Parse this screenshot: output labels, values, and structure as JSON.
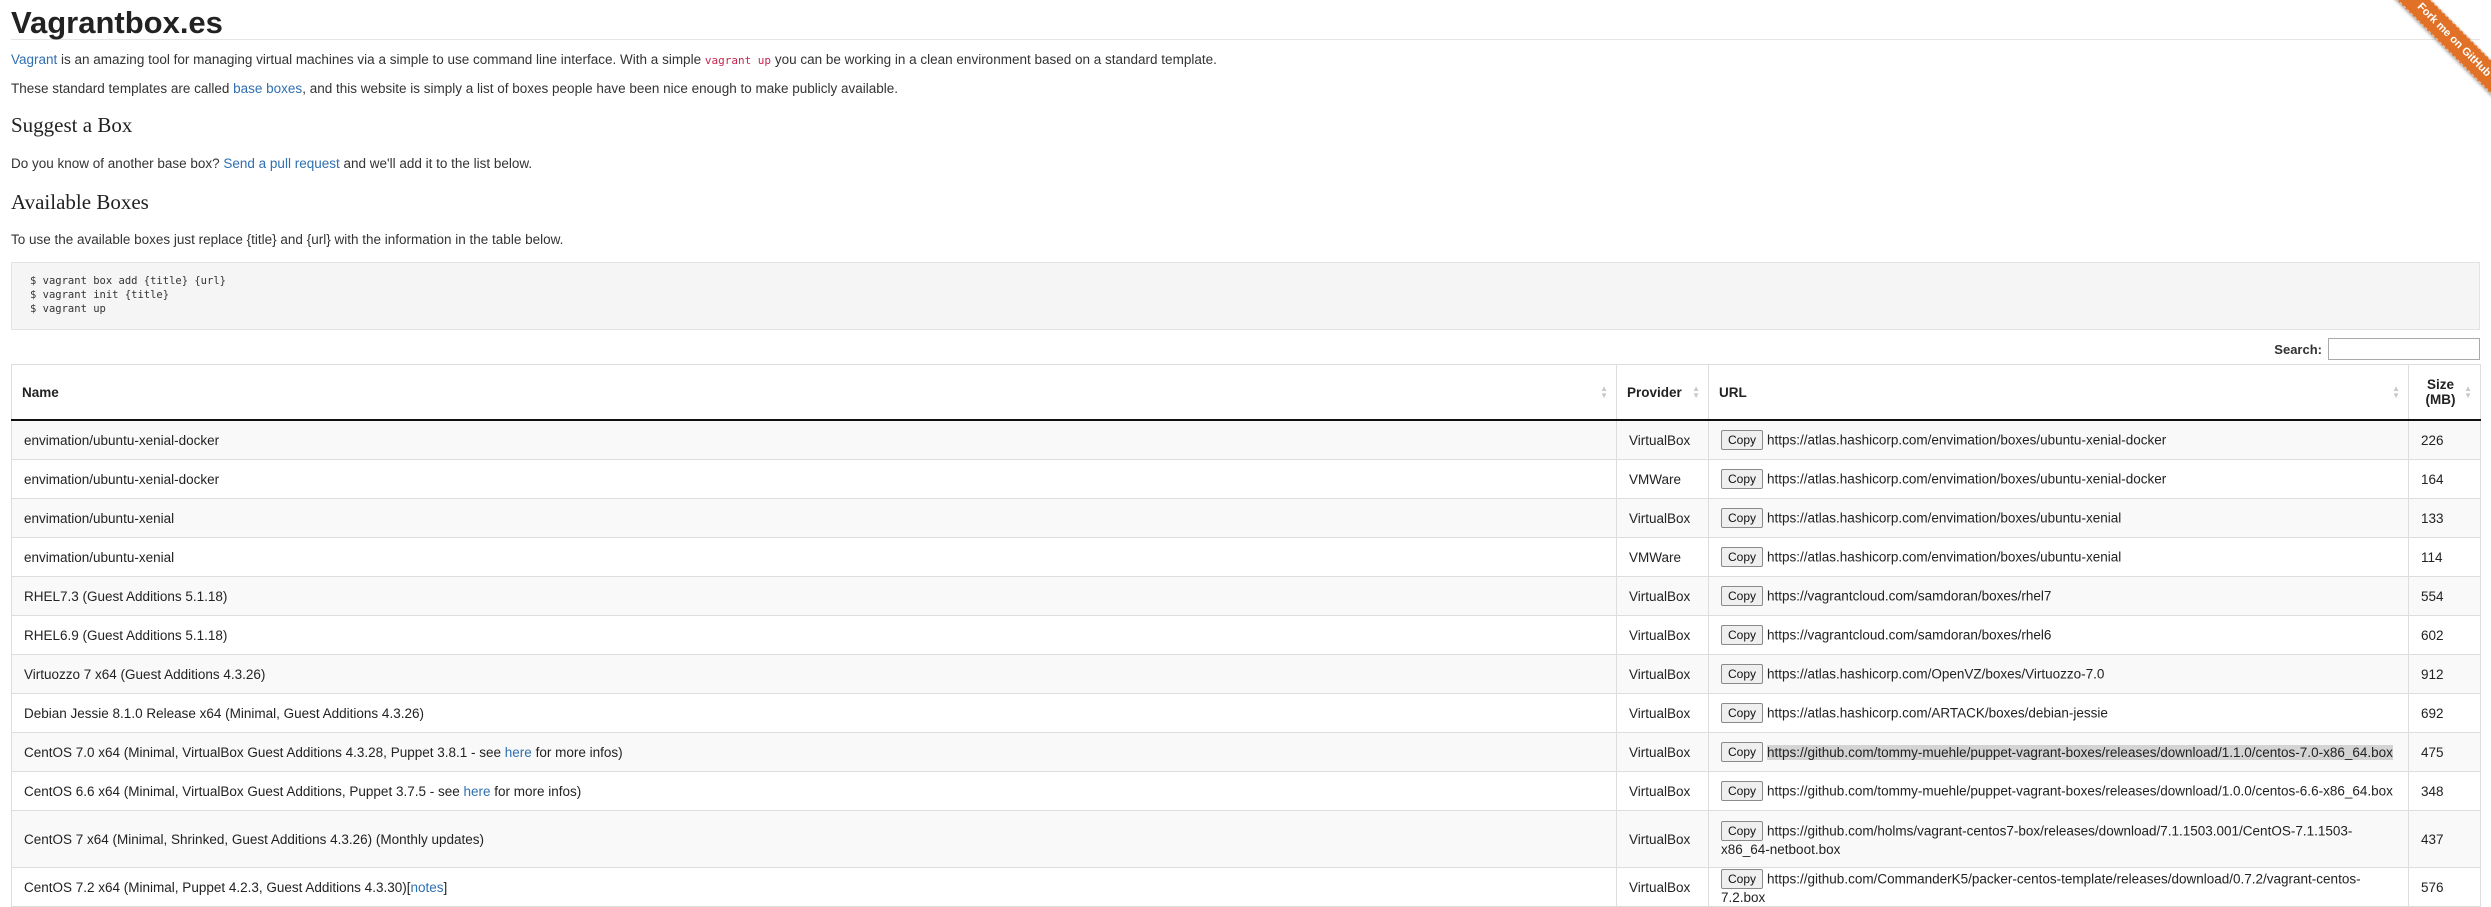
{
  "site": {
    "title": "Vagrantbox.es"
  },
  "ribbon": {
    "label": "Fork me on GitHub"
  },
  "intro": {
    "vagrant_link": "Vagrant",
    "text1": " is an amazing tool for managing virtual machines via a simple to use command line interface. With a simple ",
    "code": "vagrant up",
    "text2": " you can be working in a clean environment based on a standard template.",
    "text3": "These standard templates are called ",
    "base_boxes_link": "base boxes",
    "text4": ", and this website is simply a list of boxes people have been nice enough to make publicly available."
  },
  "suggest": {
    "heading": "Suggest a Box",
    "text1": "Do you know of another base box? ",
    "link": "Send a pull request",
    "text2": " and we'll add it to the list below."
  },
  "available": {
    "heading": "Available Boxes",
    "text": "To use the available boxes just replace {title} and {url} with the information in the table below.",
    "code_lines": [
      "$ vagrant box add {title} {url}",
      "$ vagrant init {title}",
      "$ vagrant up"
    ]
  },
  "search": {
    "label": "Search:",
    "value": ""
  },
  "table": {
    "headers": {
      "name": "Name",
      "provider": "Provider",
      "url": "URL",
      "size": "Size (MB)"
    },
    "copy_label": "Copy",
    "rows": [
      {
        "name": "envimation/ubuntu-xenial-docker",
        "provider": "VirtualBox",
        "url": "https://atlas.hashicorp.com/envimation/boxes/ubuntu-xenial-docker",
        "size": "226"
      },
      {
        "name": "envimation/ubuntu-xenial-docker",
        "provider": "VMWare",
        "url": "https://atlas.hashicorp.com/envimation/boxes/ubuntu-xenial-docker",
        "size": "164"
      },
      {
        "name": "envimation/ubuntu-xenial",
        "provider": "VirtualBox",
        "url": "https://atlas.hashicorp.com/envimation/boxes/ubuntu-xenial",
        "size": "133"
      },
      {
        "name": "envimation/ubuntu-xenial",
        "provider": "VMWare",
        "url": "https://atlas.hashicorp.com/envimation/boxes/ubuntu-xenial",
        "size": "114"
      },
      {
        "name": "RHEL7.3 (Guest Additions 5.1.18)",
        "provider": "VirtualBox",
        "url": "https://vagrantcloud.com/samdoran/boxes/rhel7",
        "size": "554"
      },
      {
        "name": "RHEL6.9 (Guest Additions 5.1.18)",
        "provider": "VirtualBox",
        "url": "https://vagrantcloud.com/samdoran/boxes/rhel6",
        "size": "602"
      },
      {
        "name": "Virtuozzo 7 x64 (Guest Additions 4.3.26)",
        "provider": "VirtualBox",
        "url": "https://atlas.hashicorp.com/OpenVZ/boxes/Virtuozzo-7.0",
        "size": "912"
      },
      {
        "name": "Debian Jessie 8.1.0 Release x64 (Minimal, Guest Additions 4.3.26)",
        "provider": "VirtualBox",
        "url": "https://atlas.hashicorp.com/ARTACK/boxes/debian-jessie",
        "size": "692"
      },
      {
        "name": "CentOS 7.0 x64 (Minimal, VirtualBox Guest Additions 4.3.28, Puppet 3.8.1 - see ",
        "link": "here",
        "name_after": " for more infos)",
        "provider": "VirtualBox",
        "url": "https://github.com/tommy-muehle/puppet-vagrant-boxes/releases/download/1.1.0/centos-7.0-x86_64.box",
        "size": "475",
        "selected": true
      },
      {
        "name": "CentOS 6.6 x64 (Minimal, VirtualBox Guest Additions, Puppet 3.7.5 - see ",
        "link": "here",
        "name_after": " for more infos)",
        "provider": "VirtualBox",
        "url": "https://github.com/tommy-muehle/puppet-vagrant-boxes/releases/download/1.0.0/centos-6.6-x86_64.box",
        "size": "348"
      },
      {
        "name": "CentOS 7 x64 (Minimal, Shrinked, Guest Additions 4.3.26) (Monthly updates)",
        "provider": "VirtualBox",
        "url": "https://github.com/holms/vagrant-centos7-box/releases/download/7.1.1503.001/CentOS-7.1.1503-x86_64-netboot.box",
        "size": "437",
        "tall": true
      },
      {
        "name": "CentOS 7.2 x64 (Minimal, Puppet 4.2.3, Guest Additions 4.3.30)[",
        "link": "notes",
        "name_after": "]",
        "provider": "VirtualBox",
        "url": "https://github.com/CommanderK5/packer-centos-template/releases/download/0.7.2/vagrant-centos-7.2.box",
        "size": "576"
      }
    ]
  }
}
